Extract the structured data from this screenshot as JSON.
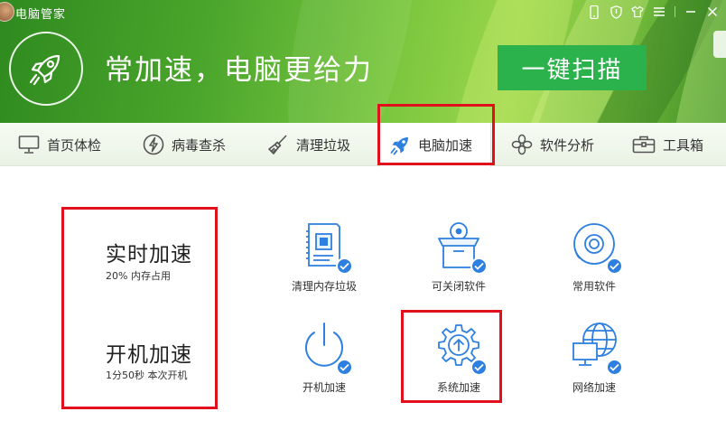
{
  "window": {
    "title": "电脑管家"
  },
  "header": {
    "slogan": "常加速，电脑更给力",
    "scan_button": "一键扫描"
  },
  "tabs": [
    {
      "label": "首页体检",
      "icon": "monitor-icon",
      "active": false
    },
    {
      "label": "病毒查杀",
      "icon": "lightning-icon",
      "active": false
    },
    {
      "label": "清理垃圾",
      "icon": "broom-icon",
      "active": false
    },
    {
      "label": "电脑加速",
      "icon": "rocket-icon",
      "active": true
    },
    {
      "label": "软件分析",
      "icon": "flower-icon",
      "active": false
    },
    {
      "label": "工具箱",
      "icon": "toolbox-icon",
      "active": false
    }
  ],
  "stats": {
    "realtime": {
      "title": "实时加速",
      "subtitle": "20% 内存占用"
    },
    "boot": {
      "title": "开机加速",
      "subtitle": "1分50秒 本次开机"
    }
  },
  "tools": [
    {
      "label": "清理内存垃圾",
      "icon": "memory-chip-icon"
    },
    {
      "label": "可关闭软件",
      "icon": "open-box-icon"
    },
    {
      "label": "常用软件",
      "icon": "disc-icon"
    },
    {
      "label": "开机加速",
      "icon": "power-icon"
    },
    {
      "label": "系统加速",
      "icon": "gear-arrow-icon"
    },
    {
      "label": "网络加速",
      "icon": "globe-monitor-icon"
    }
  ],
  "colors": {
    "accent_green": "#2bb24c",
    "check_blue": "#2d7fe0",
    "highlight_red": "#e0101c"
  }
}
